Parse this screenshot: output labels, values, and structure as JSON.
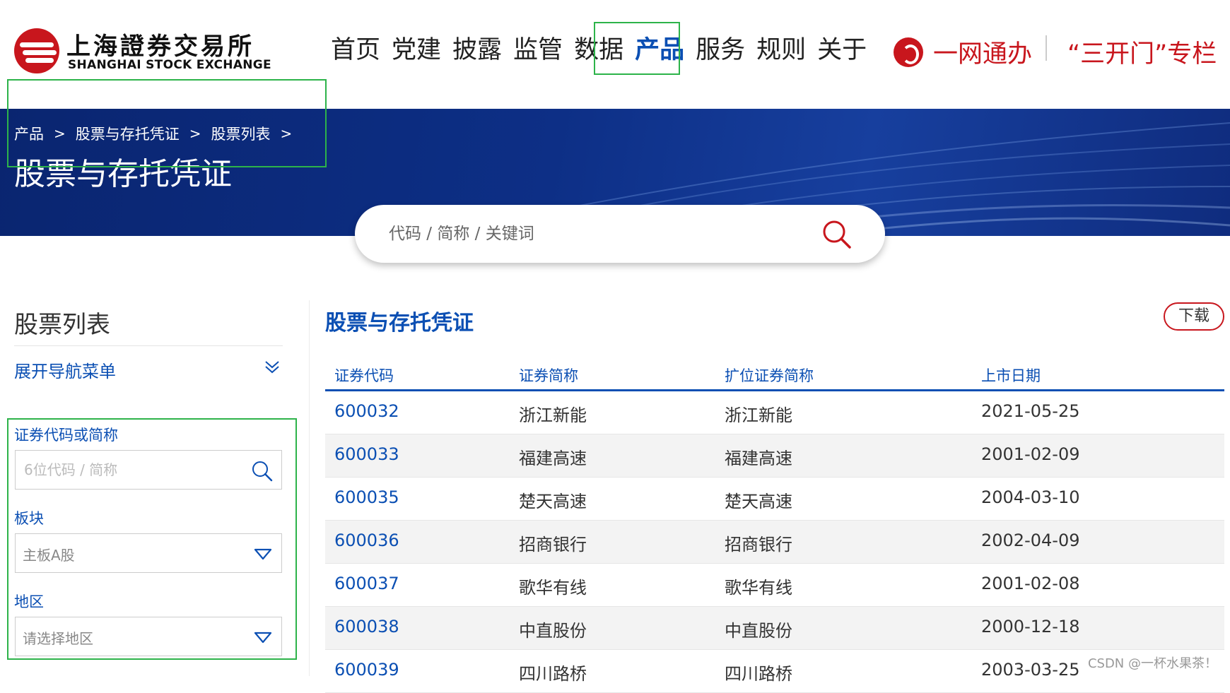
{
  "logo": {
    "cn": "上海證券交易所",
    "en": "SHANGHAI STOCK EXCHANGE"
  },
  "nav": {
    "items": [
      "首页",
      "党建",
      "披露",
      "监管",
      "数据",
      "产品",
      "服务",
      "规则",
      "关于"
    ],
    "active_index": 5
  },
  "header_right": {
    "ywtb": "一网通办",
    "skm": "“三开门”专栏"
  },
  "breadcrumb": {
    "items": [
      "产品",
      "股票与存托凭证",
      "股票列表"
    ],
    "separator": ">"
  },
  "banner": {
    "title": "股票与存托凭证"
  },
  "search": {
    "placeholder": "代码 / 简称 / 关键词"
  },
  "sidebar": {
    "title": "股票列表",
    "expand_label": "展开导航菜单",
    "filters": {
      "code_label": "证券代码或简称",
      "code_placeholder": "6位代码 / 简称",
      "board_label": "板块",
      "board_value": "主板A股",
      "region_label": "地区",
      "region_value": "请选择地区"
    }
  },
  "main": {
    "title": "股票与存托凭证",
    "download_label": "下载",
    "columns": [
      "证券代码",
      "证券简称",
      "扩位证券简称",
      "上市日期"
    ],
    "rows": [
      [
        "600032",
        "浙江新能",
        "浙江新能",
        "2021-05-25"
      ],
      [
        "600033",
        "福建高速",
        "福建高速",
        "2001-02-09"
      ],
      [
        "600035",
        "楚天高速",
        "楚天高速",
        "2004-03-10"
      ],
      [
        "600036",
        "招商银行",
        "招商银行",
        "2002-04-09"
      ],
      [
        "600037",
        "歌华有线",
        "歌华有线",
        "2001-02-08"
      ],
      [
        "600038",
        "中直股份",
        "中直股份",
        "2000-12-18"
      ],
      [
        "600039",
        "四川路桥",
        "四川路桥",
        "2003-03-25"
      ]
    ]
  },
  "watermark": "CSDN @一杯水果茶！",
  "colors": {
    "brand_red": "#c8161d",
    "brand_blue": "#0b4fb3",
    "banner_navy": "#0d2f86",
    "highlight_green": "#2db34a"
  }
}
